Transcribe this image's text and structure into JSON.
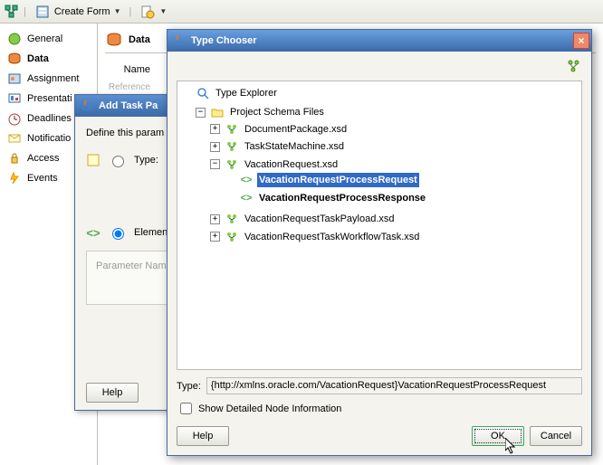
{
  "toolbar": {
    "create_form_label": "Create Form"
  },
  "sidebar": {
    "items": [
      {
        "label": "General"
      },
      {
        "label": "Data"
      },
      {
        "label": "Assignment"
      },
      {
        "label": "Presentati"
      },
      {
        "label": "Deadlines"
      },
      {
        "label": "Notificatio"
      },
      {
        "label": "Access"
      },
      {
        "label": "Events"
      }
    ]
  },
  "content": {
    "tab_label": "Data",
    "name_label": "Name",
    "ref_placeholder": "Reference"
  },
  "atp": {
    "title": "Add Task Pa",
    "define_text": "Define this param",
    "type_label": "Type:",
    "element_label": "Element",
    "param_name_label": "Parameter Name",
    "help_label": "Help"
  },
  "tc": {
    "title": "Type Chooser",
    "tree": {
      "root": "Type Explorer",
      "psf": "Project Schema Files",
      "docpkg": "DocumentPackage.xsd",
      "tsm": "TaskStateMachine.xsd",
      "vr": "VacationRequest.xsd",
      "vr_req": "VacationRequestProcessRequest",
      "vr_resp": "VacationRequestProcessResponse",
      "vrtp": "VacationRequestTaskPayload.xsd",
      "vrtwt": "VacationRequestTaskWorkflowTask.xsd"
    },
    "type_label": "Type:",
    "type_value": "{http://xmlns.oracle.com/VacationRequest}VacationRequestProcessRequest",
    "show_detail_label": "Show Detailed Node Information",
    "help_label": "Help",
    "ok_label": "OK",
    "cancel_label": "Cancel"
  }
}
